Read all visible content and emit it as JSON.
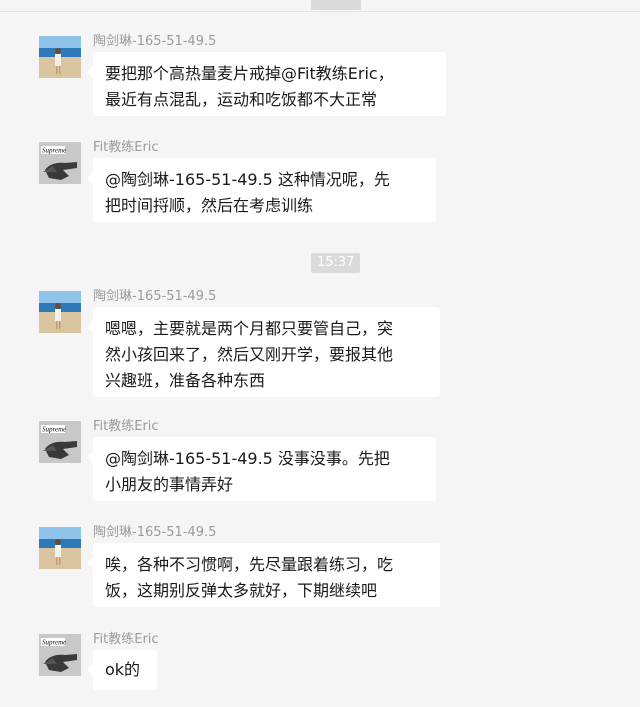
{
  "chat": {
    "top_timestamp": "",
    "time_divider": "15:37",
    "messages": [
      {
        "sender": "陶剑琳-165-51-49.5",
        "avatar": "beach-photo-avatar",
        "text": "要把那个高热量麦片戒掉@Fit教练Eric，\n最近有点混乱，运动和吃饭都不大正常"
      },
      {
        "sender": "Fit教练Eric",
        "avatar": "supreme-hand-avatar",
        "text": "@陶剑琳-165-51-49.5 这种情况呢，先\n把时间捋顺，然后在考虑训练"
      },
      {
        "sender": "陶剑琳-165-51-49.5",
        "avatar": "beach-photo-avatar",
        "text": "嗯嗯，主要就是两个月都只要管自己，突\n然小孩回来了，然后又刚开学，要报其他\n兴趣班，准备各种东西"
      },
      {
        "sender": "Fit教练Eric",
        "avatar": "supreme-hand-avatar",
        "text": "@陶剑琳-165-51-49.5 没事没事。先把\n小朋友的事情弄好"
      },
      {
        "sender": "陶剑琳-165-51-49.5",
        "avatar": "beach-photo-avatar",
        "text": "唉，各种不习惯啊，先尽量跟着练习，吃\n饭，这期别反弹太多就好，下期继续吧"
      },
      {
        "sender": "Fit教练Eric",
        "avatar": "supreme-hand-avatar",
        "text": "ok的"
      }
    ]
  },
  "colors": {
    "background": "#f5f5f5",
    "bubble": "#ffffff",
    "sender_name": "#9b9b9b",
    "timestamp_bg": "#dadada"
  }
}
